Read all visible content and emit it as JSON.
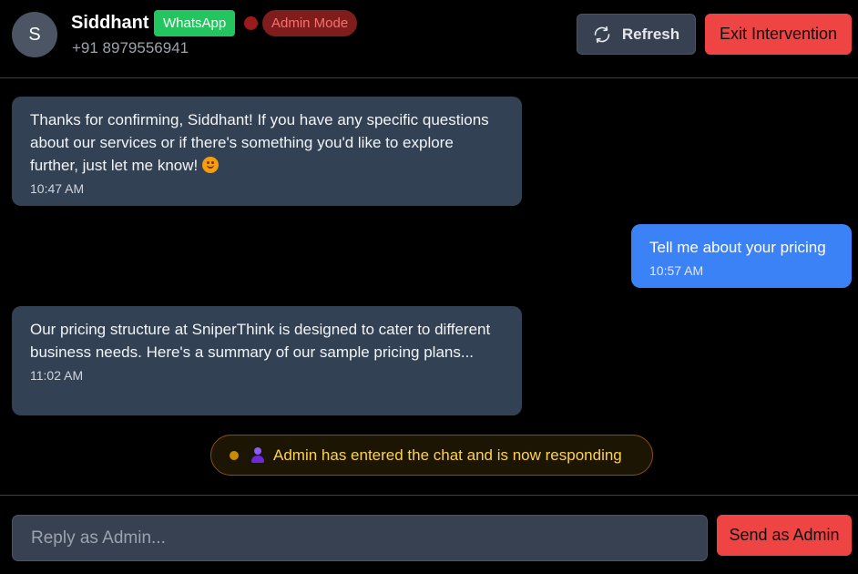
{
  "contact": {
    "avatar_initial": "S",
    "name": "Siddhant",
    "channel_badge": "WhatsApp",
    "mode_badge": "Admin Mode",
    "phone": "+91 8979556941"
  },
  "actions": {
    "refresh_label": "Refresh",
    "exit_label": "Exit Intervention"
  },
  "messages": [
    {
      "direction": "incoming",
      "text": "Thanks for confirming, Siddhant! If you have any specific questions about our services or if there's something you'd like to explore further, just let me know!",
      "emoji": "smiling-face",
      "time": "10:47 AM"
    },
    {
      "direction": "outgoing",
      "text": "Tell me about your pricing",
      "time": "10:57 AM"
    },
    {
      "direction": "incoming",
      "text": "Our pricing structure at SniperThink is designed to cater to different business needs. Here's a summary of our sample pricing plans...",
      "time": "11:02 AM"
    }
  ],
  "system_notice": {
    "icon": "person-icon",
    "text": "Admin has entered the chat and is now responding"
  },
  "composer": {
    "placeholder": "Reply as Admin...",
    "value": "",
    "send_label": "Send as Admin"
  },
  "colors": {
    "whatsapp": "#22c55e",
    "danger": "#ef4444",
    "outgoing_bubble": "#3b82f6",
    "incoming_bubble": "#334155",
    "notice_text": "#fcd34d"
  }
}
